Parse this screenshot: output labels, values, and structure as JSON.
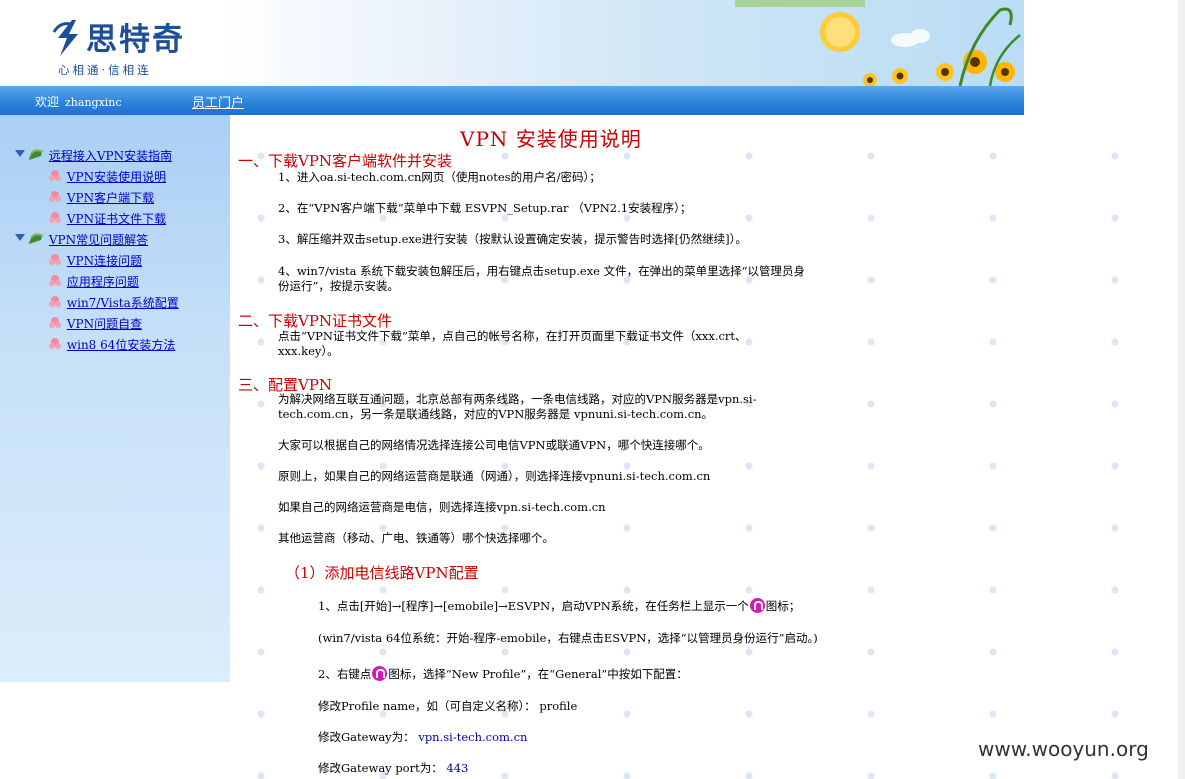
{
  "header": {
    "logo_text": "思特奇",
    "logo_slogan": "心相通·信相连"
  },
  "navbar": {
    "welcome": "欢迎",
    "username": "zhangxinc",
    "portal_link": "员工门户"
  },
  "sidebar": {
    "groups": [
      {
        "label": "远程接入VPN安装指南",
        "items": [
          "VPN安装使用说明",
          "VPN客户端下载",
          "VPN证书文件下载"
        ]
      },
      {
        "label": "VPN常见问题解答",
        "items": [
          "VPN连接问题",
          "应用程序问题",
          "win7/Vista系统配置",
          "VPN问题自查",
          "win8 64位安装方法"
        ]
      }
    ]
  },
  "doc": {
    "title": "VPN 安装使用说明",
    "s1": {
      "heading": "一、下载VPN客户端软件并安装",
      "p1": "1、进入oa.si-tech.com.cn网页（使用notes的用户名/密码）；",
      "p2": "2、在“VPN客户端下载”菜单中下载 ESVPN_Setup.rar （VPN2.1安装程序）；",
      "p3": "3、解压缩并双击setup.exe进行安装（按默认设置确定安装，提示警告时选择[仍然继续]）。",
      "p4a": "4、win7/vista 系统下载安装包解压后，用右键点击setup.exe 文件，在弹出的菜单里选择“以管理员身",
      "p4b": "份运行”，按提示安装。"
    },
    "s2": {
      "heading": "二、下载VPN证书文件",
      "p1a": "点击“VPN证书文件下载”菜单，点自己的帐号名称，在打开页面里下载证书文件（xxx.crt、",
      "p1b": "xxx.key）。"
    },
    "s3": {
      "heading": "三、配置VPN",
      "p1a": "为解决网络互联互通问题，北京总部有两条线路，一条电信线路，对应的VPN服务器是vpn.si-",
      "p1b": "tech.com.cn，另一条是联通线路，对应的VPN服务器是 vpnuni.si-tech.com.cn。",
      "p2": "大家可以根据自己的网络情况选择连接公司电信VPN或联通VPN，哪个快连接哪个。",
      "p3": "原则上，如果自己的网络运营商是联通（网通），则选择连接vpnuni.si-tech.com.cn",
      "p4": "如果自己的网络运营商是电信，则选择连接vpn.si-tech.com.cn",
      "p5": "其他运营商（移动、广电、铁通等）哪个快选择哪个。",
      "sub1_heading": "（1）添加电信线路VPN配置",
      "step1_pre": "1、点击[开始]→[程序]→[emobile]→ESVPN，启动VPN系统，在任务栏上显示一个",
      "step1_post": "图标；",
      "step1_note": "(win7/vista 64位系统：开始-程序-emobile，右键点击ESVPN，选择“以管理员身份运行”启动。)",
      "step2_pre": "2、右键点",
      "step2_post": "图标，选择“New Profile”，在“General”中按如下配置：",
      "profile_label": "修改Profile name，如（可自定义名称）：",
      "profile_value": "profile",
      "gateway_label": "修改Gateway为：",
      "gateway_value": "vpn.si-tech.com.cn",
      "port_label": "修改Gateway port为：",
      "port_value": "443"
    }
  },
  "watermark": "www.wooyun.org",
  "colors": {
    "heading_red": "#cc0000",
    "link_blue": "#0000cc",
    "nav_blue": "#2f84dd",
    "vpn_icon": "#d41ab6"
  }
}
